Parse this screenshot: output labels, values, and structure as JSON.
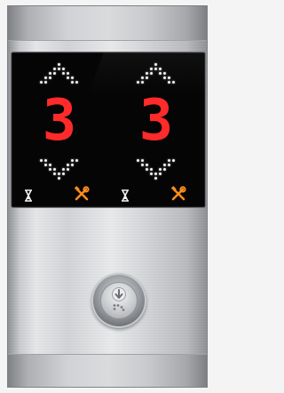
{
  "elevator_panel": {
    "left_display": {
      "floor_number": "3",
      "up_arrow_icon": "chevron-up-dot-matrix",
      "down_arrow_icon": "chevron-down-dot-matrix",
      "status_icons": [
        "hourglass-icon",
        "tools-icon"
      ]
    },
    "right_display": {
      "floor_number": "3",
      "up_arrow_icon": "chevron-up-dot-matrix",
      "down_arrow_icon": "chevron-down-dot-matrix",
      "status_icons": [
        "hourglass-icon",
        "tools-icon"
      ]
    },
    "call_button": {
      "direction": "down",
      "icon": "down-arrow-icon",
      "braille_icon": "braille-icon"
    },
    "colors": {
      "digit_red": "#ff2a2a",
      "dot_white": "#f2f2f2",
      "tools_orange": "#ff8c1a",
      "display_bg": "#050505"
    }
  }
}
